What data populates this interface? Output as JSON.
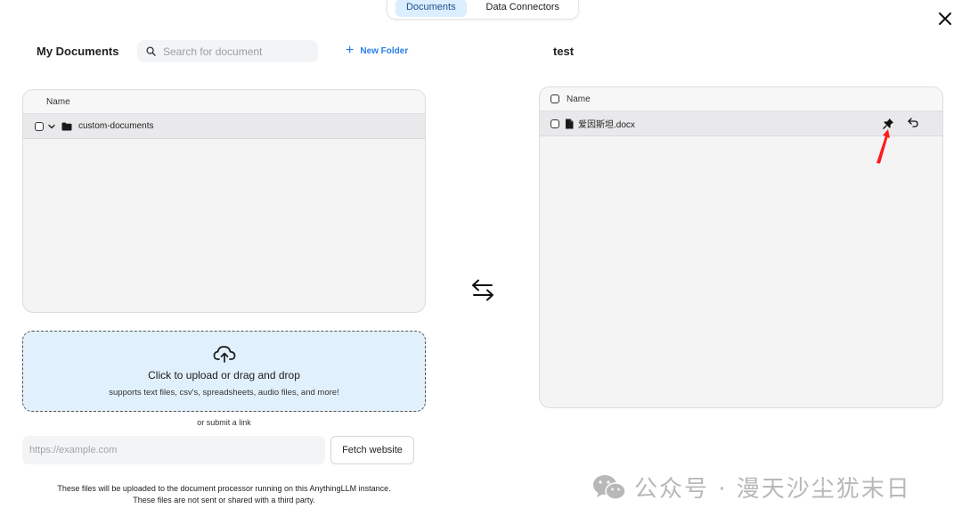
{
  "tabs": [
    {
      "label": "Documents",
      "active": true
    },
    {
      "label": "Data Connectors",
      "active": false
    }
  ],
  "left": {
    "title": "My Documents",
    "search_placeholder": "Search for document",
    "new_folder_label": "New Folder",
    "column_name": "Name",
    "folder_name": "custom-documents"
  },
  "upload": {
    "title": "Click to upload or drag and drop",
    "subtitle": "supports text files, csv's, spreadsheets, audio files, and more!",
    "or_link": "or submit a link",
    "url_placeholder": "https://example.com",
    "fetch_label": "Fetch website",
    "footnote_line1": "These files will be uploaded to the document processor running on this AnythingLLM instance.",
    "footnote_line2": "These files are not sent or shared with a third party."
  },
  "right": {
    "title": "test",
    "column_name": "Name",
    "file_name": "爱因斯坦.docx"
  },
  "watermark": "公众号 · 漫天沙尘犹末日",
  "colors": {
    "accent": "#2b7de9",
    "active_tab_bg": "#dbeeff",
    "upload_bg": "#e0f0fc",
    "annotation_arrow": "#ff1a1a"
  }
}
